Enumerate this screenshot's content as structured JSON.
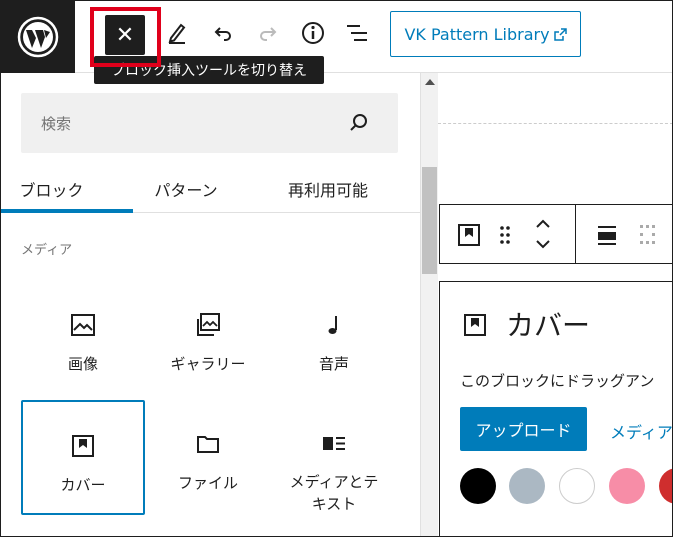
{
  "toolbar": {
    "toggle_inserter_icon": "close-icon",
    "tooltip": "ブロック挿入ツールを切り替え",
    "vk_button_label": "VK Pattern Library"
  },
  "inserter": {
    "search_placeholder": "検索",
    "tabs": [
      {
        "label": "ブロック",
        "active": true
      },
      {
        "label": "パターン",
        "active": false
      },
      {
        "label": "再利用可能",
        "active": false
      }
    ],
    "category": "メディア",
    "blocks": [
      {
        "label": "画像",
        "icon": "image-icon",
        "selected": false
      },
      {
        "label": "ギャラリー",
        "icon": "gallery-icon",
        "selected": false
      },
      {
        "label": "音声",
        "icon": "audio-icon",
        "selected": false
      },
      {
        "label": "カバー",
        "icon": "cover-icon",
        "selected": true
      },
      {
        "label": "ファイル",
        "icon": "file-icon",
        "selected": false
      },
      {
        "label": "メディアとテキスト",
        "icon": "media-text-icon",
        "selected": false
      }
    ]
  },
  "editor": {
    "cover": {
      "title": "カバー",
      "description": "このブロックにドラッグアン",
      "upload_label": "アップロード",
      "media_label": "メディア"
    },
    "swatches": [
      "#000000",
      "#abb8c3",
      "#ffffff",
      "#f78da7",
      "#cf2e2e"
    ]
  },
  "colors": {
    "accent": "#007cba",
    "dark": "#1e1e1e",
    "highlight": "#e0001b"
  }
}
